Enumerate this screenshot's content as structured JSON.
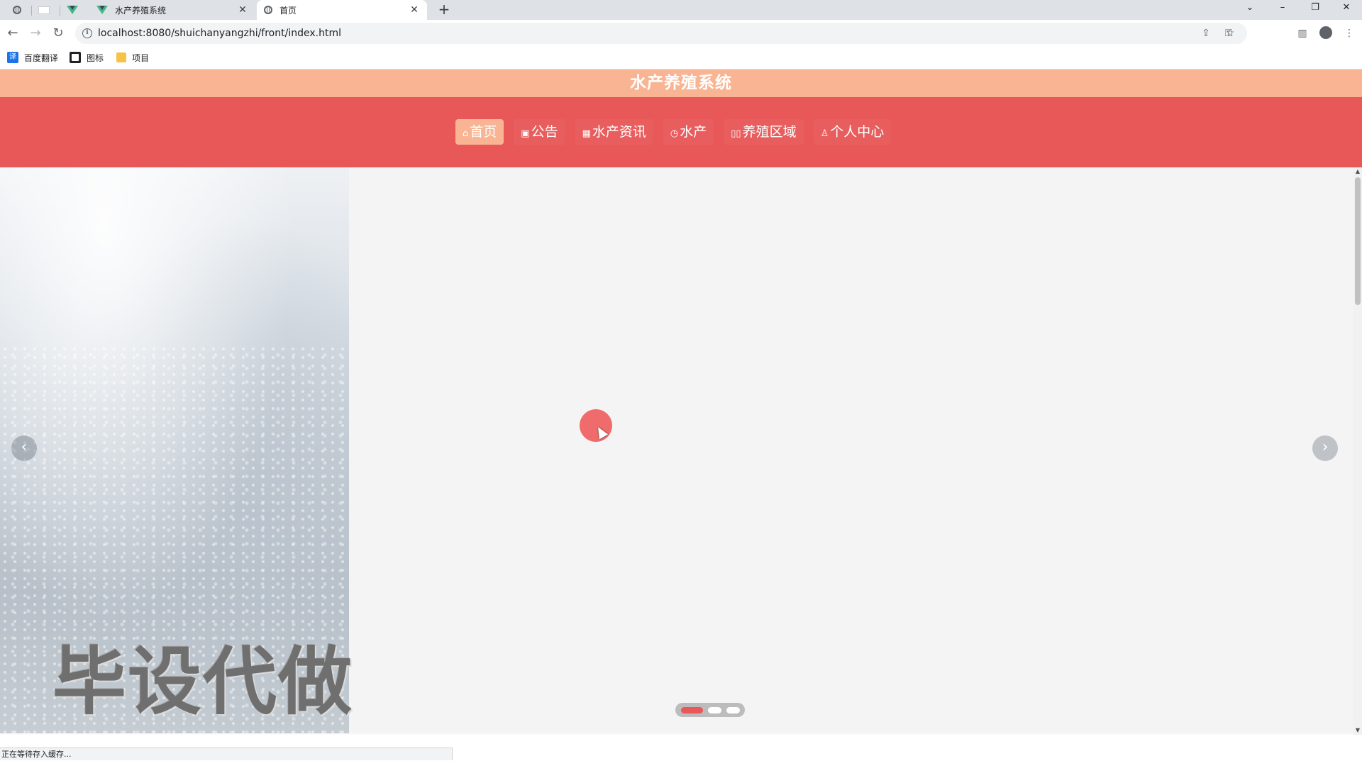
{
  "browser": {
    "tabs": [
      {
        "title": "水产养殖系统",
        "icon": "vue-icon"
      },
      {
        "title": "首页",
        "icon": "globe-icon",
        "active": true
      }
    ],
    "new_tab": "+",
    "close_glyph": "✕",
    "url": "localhost:8080/shuichanyangzhi/front/index.html",
    "bookmarks": [
      {
        "label": "百度翻译",
        "icon": "translate-icon"
      },
      {
        "label": "图标",
        "icon": "image-icon"
      },
      {
        "label": "项目",
        "icon": "folder-icon"
      }
    ],
    "status_text": "正在等待存入缓存..."
  },
  "site": {
    "title": "水产养殖系统",
    "nav": [
      {
        "label": "首页",
        "icon": "home-icon",
        "active": true
      },
      {
        "label": "公告",
        "icon": "gift-icon"
      },
      {
        "label": "水产资讯",
        "icon": "grid-icon"
      },
      {
        "label": "水产",
        "icon": "clock-icon"
      },
      {
        "label": "养殖区域",
        "icon": "columns-icon"
      },
      {
        "label": "个人中心",
        "icon": "user-icon"
      }
    ]
  },
  "carousel": {
    "watermark": "毕设代做",
    "active_index": 0,
    "slide_count": 3
  },
  "colors": {
    "title_bar": "#f9b593",
    "nav_bar": "#e85858",
    "accent": "#e85858"
  }
}
